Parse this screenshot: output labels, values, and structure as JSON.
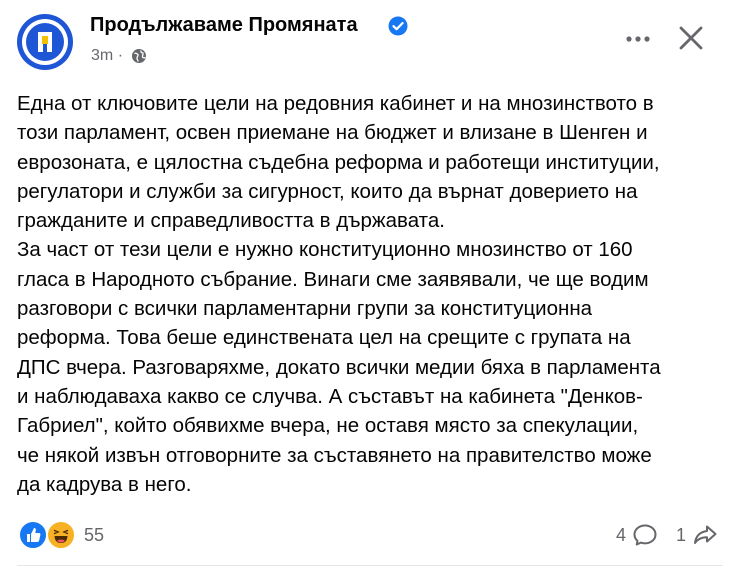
{
  "post": {
    "page_name": "Продължаваме Промяната",
    "time": "3m",
    "separator": "·",
    "lines": [
      "Една от ключовите цели на редовния кабинет и на мнозинството в",
      "този парламент, освен приемане на бюджет и влизане в Шенген и",
      "еврозоната, е цялостна съдебна реформа и работещи институции,",
      "регулатори и служби за сигурност, които да върнат доверието на",
      "гражданите и справедливостта в държавата.",
      "За част от тези цели е нужно конституционно мнозинство от 160",
      "гласа в Народното събрание. Винаги сме заявявали, че ще водим",
      "разговори с всички парламентарни групи за конституционна",
      "реформа. Това беше единствената цел на срещите с групата на",
      "ДПС вчера. Разговаряхме, докато всички медии бяха в парламента",
      "и наблюдаваха какво се случва. А съставът на кабинета \"Денков-",
      "Габриел\", който обявихме вчера, не оставя място за спекулации,",
      "че някой извън отговорните за съставянето на правителство може",
      "да кадрува в него."
    ]
  },
  "footer": {
    "reactions_count": "55",
    "comments_count": "4",
    "shares_count": "1"
  },
  "icons": {
    "verified": "verified-badge-icon",
    "audience": "globe-icon",
    "more": "more-options-icon",
    "close": "close-icon",
    "like": "like-reaction-icon",
    "haha": "haha-reaction-icon",
    "comment": "comment-icon",
    "share": "share-icon"
  },
  "colors": {
    "brand_blue": "#1f56d6",
    "verified_blue": "#1877f2",
    "secondary_text": "#65676b",
    "text": "#050505"
  }
}
